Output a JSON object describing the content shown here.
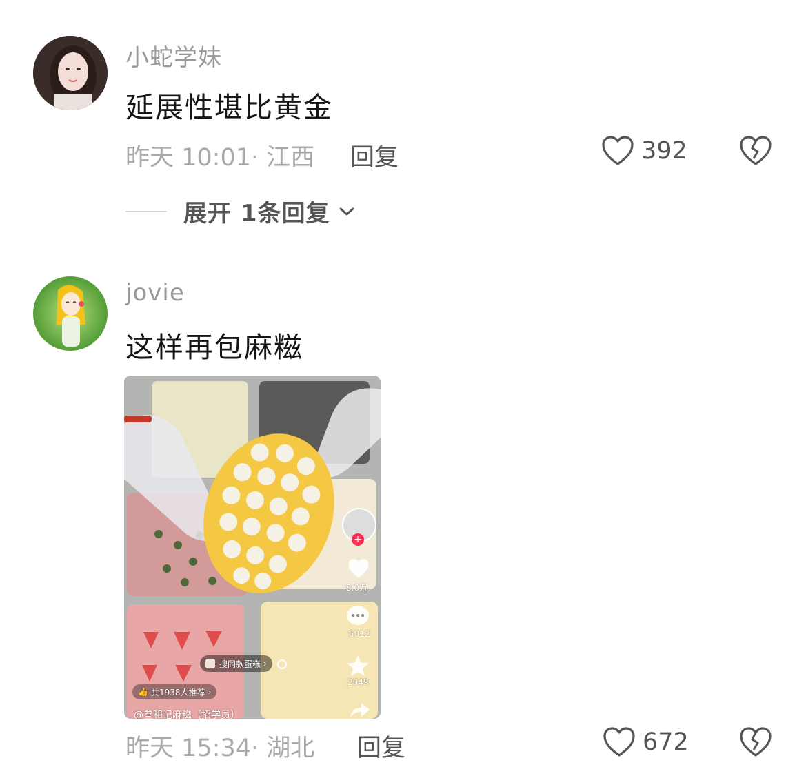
{
  "comments": [
    {
      "username": "小蛇学妹",
      "text": "延展性堪比黄金",
      "time": "昨天 10:01",
      "location": "江西",
      "reply_label": "回复",
      "likes": "392",
      "expand_label": "展开 1条回复"
    },
    {
      "username": "jovie",
      "text": "这样再包麻糍",
      "time": "昨天 15:34",
      "location": "湖北",
      "reply_label": "回复",
      "likes": "672",
      "video": {
        "like_count": "8.0万",
        "comment_count": "5012",
        "fav_count": "2049",
        "search_tag": "搜同款蛋糕",
        "recommend": "共1938人推荐",
        "author": "@叁和记麻糍（招学员）"
      }
    }
  ],
  "colors": {
    "accent_red": "#ff2d55",
    "pineapple_yellow": "#f4c842"
  }
}
